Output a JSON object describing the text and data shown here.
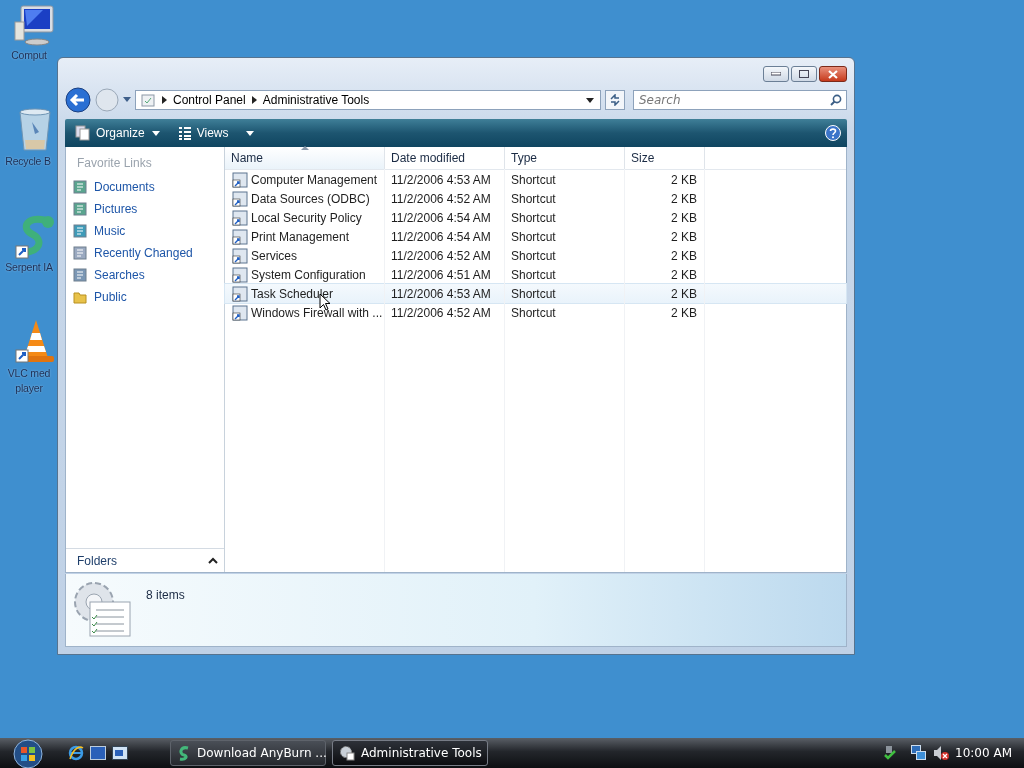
{
  "desktop_icons": [
    {
      "kind": "computer",
      "lines": [
        "Comput"
      ]
    },
    {
      "kind": "recycle",
      "lines": [
        "Recycle B"
      ]
    },
    {
      "kind": "serpent",
      "lines": [
        "Serpent IA"
      ]
    },
    {
      "kind": "vlc",
      "lines": [
        "VLC med",
        "player"
      ]
    }
  ],
  "window": {
    "address": [
      "Control Panel",
      "Administrative Tools"
    ],
    "search": {
      "placeholder": "Search"
    },
    "toolbar": [
      {
        "label": "Organize"
      },
      {
        "label": "Views"
      }
    ],
    "favorite_links": {
      "title": "Favorite Links",
      "items": [
        {
          "label": "Documents",
          "kind": "documents"
        },
        {
          "label": "Pictures",
          "kind": "pictures"
        },
        {
          "label": "Music",
          "kind": "music"
        },
        {
          "label": "Recently Changed",
          "kind": "recent"
        },
        {
          "label": "Searches",
          "kind": "searches"
        },
        {
          "label": "Public",
          "kind": "folder"
        }
      ]
    },
    "folders": "Folders",
    "columns": [
      {
        "label": "Name",
        "sorted": true
      },
      {
        "label": "Date modified",
        "sorted": false
      },
      {
        "label": "Type",
        "sorted": false
      },
      {
        "label": "Size",
        "sorted": false
      }
    ],
    "rows": [
      {
        "name": "Computer Management",
        "date": "11/2/2006 4:53 AM",
        "type": "Shortcut",
        "size": "2 KB",
        "hovered": false
      },
      {
        "name": "Data Sources (ODBC)",
        "date": "11/2/2006 4:52 AM",
        "type": "Shortcut",
        "size": "2 KB",
        "hovered": false
      },
      {
        "name": "Local Security Policy",
        "date": "11/2/2006 4:54 AM",
        "type": "Shortcut",
        "size": "2 KB",
        "hovered": false
      },
      {
        "name": "Print Management",
        "date": "11/2/2006 4:54 AM",
        "type": "Shortcut",
        "size": "2 KB",
        "hovered": false
      },
      {
        "name": "Services",
        "date": "11/2/2006 4:52 AM",
        "type": "Shortcut",
        "size": "2 KB",
        "hovered": false
      },
      {
        "name": "System Configuration",
        "date": "11/2/2006 4:51 AM",
        "type": "Shortcut",
        "size": "2 KB",
        "hovered": false
      },
      {
        "name": "Task Scheduler",
        "date": "11/2/2006 4:53 AM",
        "type": "Shortcut",
        "size": "2 KB",
        "hovered": true
      },
      {
        "name": "Windows Firewall with ...",
        "date": "11/2/2006 4:52 AM",
        "type": "Shortcut",
        "size": "2 KB",
        "hovered": false
      }
    ],
    "status": "8 items"
  },
  "taskbar": {
    "tasks": [
      {
        "label": "Download AnyBurn ...",
        "selected": false
      },
      {
        "label": "Administrative Tools",
        "selected": true
      }
    ],
    "clock": "10:00 AM"
  }
}
